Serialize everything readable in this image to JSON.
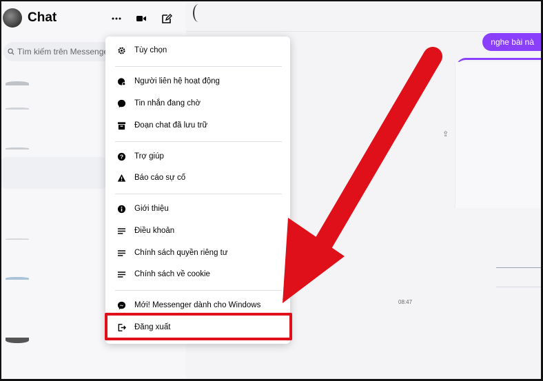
{
  "header": {
    "title": "Chat"
  },
  "search": {
    "placeholder": "Tìm kiếm trên Messenger"
  },
  "menu": {
    "items": [
      {
        "label": "Tùy chọn",
        "icon": "gear-icon"
      },
      {
        "label": "Người liên hệ hoạt động",
        "icon": "active-contacts-icon"
      },
      {
        "label": "Tin nhắn đang chờ",
        "icon": "chat-bubble-icon"
      },
      {
        "label": "Đoạn chat đã lưu trữ",
        "icon": "archive-icon"
      },
      {
        "label": "Trợ giúp",
        "icon": "help-icon"
      },
      {
        "label": "Báo cáo sự cố",
        "icon": "warning-icon"
      },
      {
        "label": "Giới thiệu",
        "icon": "info-icon"
      },
      {
        "label": "Điều khoản",
        "icon": "lines-icon"
      },
      {
        "label": "Chính sách quyền riêng tư",
        "icon": "lines-icon"
      },
      {
        "label": "Chính sách về cookie",
        "icon": "lines-icon"
      },
      {
        "label": "Mới! Messenger dành cho Windows",
        "icon": "messenger-icon"
      },
      {
        "label": "Đăng xuất",
        "icon": "logout-icon"
      }
    ]
  },
  "chat": {
    "bubble_text": "nghe bài nà",
    "time": "08:47"
  },
  "colors": {
    "accent": "#8a3ffc",
    "highlight_red": "#e0101a"
  }
}
